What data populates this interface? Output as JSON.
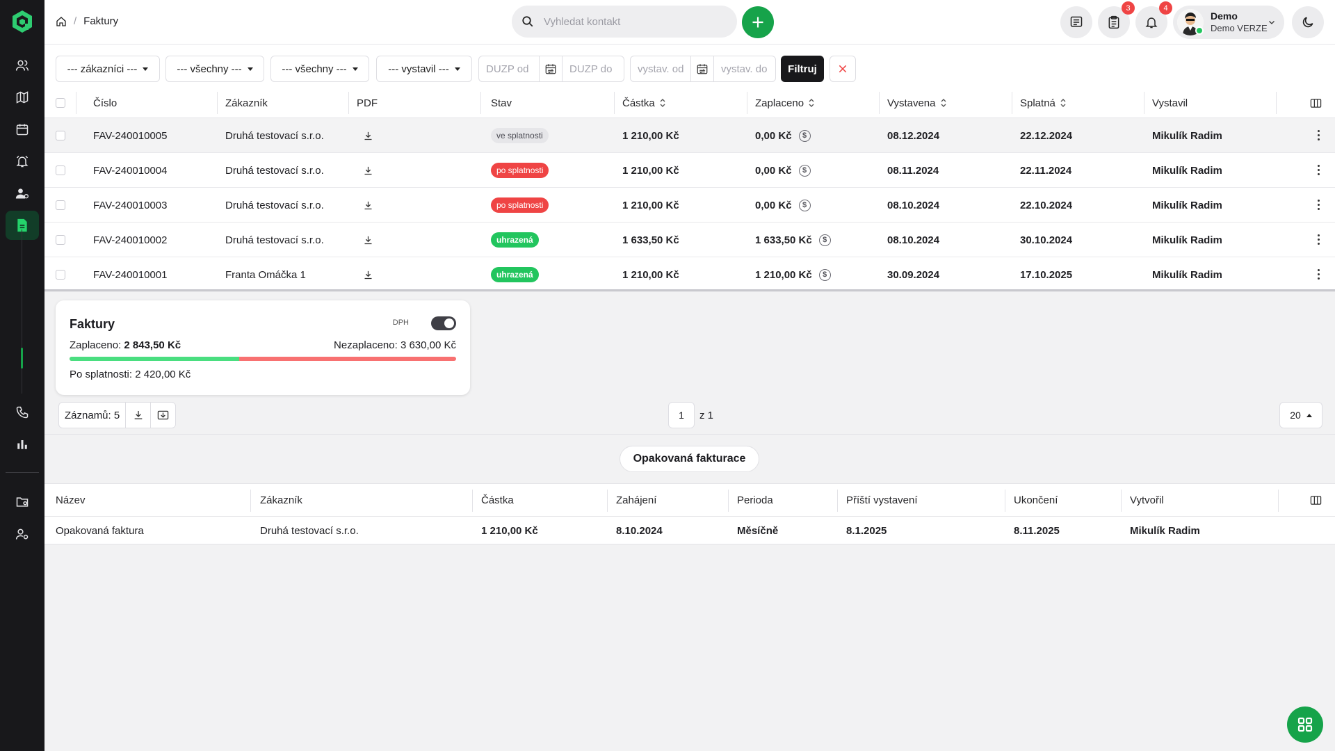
{
  "breadcrumb": {
    "current": "Faktury"
  },
  "search": {
    "placeholder": "Vyhledat kontakt"
  },
  "badges": {
    "tasks": "3",
    "notifications": "4"
  },
  "user": {
    "name": "Demo",
    "subtitle": "Demo VERZE"
  },
  "filters": {
    "customers": "--- zákazníci ---",
    "all1": "--- všechny ---",
    "all2": "--- všechny ---",
    "issuer": "--- vystavil ---",
    "duzp_from": "DUZP od",
    "duzp_to": "DUZP do",
    "issued_from": "vystav. od",
    "issued_to": "vystav. do",
    "filter_button": "Filtruj"
  },
  "invoices": {
    "headers": {
      "number": "Číslo",
      "customer": "Zákazník",
      "pdf": "PDF",
      "status": "Stav",
      "amount": "Částka",
      "paid": "Zaplaceno",
      "issued": "Vystavena",
      "due": "Splatná",
      "issuer": "Vystavil"
    },
    "rows": [
      {
        "number": "FAV-240010005",
        "customer": "Druhá testovací s.r.o.",
        "status": "ve splatnosti",
        "amount": "1 210,00 Kč",
        "paid": "0,00 Kč",
        "issued": "08.12.2024",
        "due": "22.12.2024",
        "issuer": "Mikulík Radim"
      },
      {
        "number": "FAV-240010004",
        "customer": "Druhá testovací s.r.o.",
        "status": "po splatnosti",
        "amount": "1 210,00 Kč",
        "paid": "0,00 Kč",
        "issued": "08.11.2024",
        "due": "22.11.2024",
        "issuer": "Mikulík Radim"
      },
      {
        "number": "FAV-240010003",
        "customer": "Druhá testovací s.r.o.",
        "status": "po splatnosti",
        "amount": "1 210,00 Kč",
        "paid": "0,00 Kč",
        "issued": "08.10.2024",
        "due": "22.10.2024",
        "issuer": "Mikulík Radim"
      },
      {
        "number": "FAV-240010002",
        "customer": "Druhá testovací s.r.o.",
        "status": "uhrazená",
        "amount": "1 633,50 Kč",
        "paid": "1 633,50 Kč",
        "issued": "08.10.2024",
        "due": "30.10.2024",
        "issuer": "Mikulík Radim"
      },
      {
        "number": "FAV-240010001",
        "customer": "Franta Omáčka 1",
        "status": "uhrazená",
        "amount": "1 210,00 Kč",
        "paid": "1 210,00 Kč",
        "issued": "30.09.2024",
        "due": "17.10.2025",
        "issuer": "Mikulík Radim"
      }
    ]
  },
  "summary": {
    "title": "Faktury",
    "dph_label": "DPH",
    "paid_label": "Zaplaceno:",
    "paid_value": "2 843,50 Kč",
    "unpaid_label": "Nezaplaceno:",
    "unpaid_value": "3 630,00 Kč",
    "overdue_label": "Po splatnosti:",
    "overdue_value": "2 420,00 Kč",
    "paid_fraction": 0.439
  },
  "pagination": {
    "records_label": "Záznamů:",
    "records_count": "5",
    "page": "1",
    "of": "z 1",
    "per_page": "20"
  },
  "recurring": {
    "button": "Opakovaná fakturace",
    "headers": {
      "name": "Název",
      "customer": "Zákazník",
      "amount": "Částka",
      "start": "Zahájení",
      "period": "Perioda",
      "next": "Příští vystavení",
      "end": "Ukončení",
      "creator": "Vytvořil"
    },
    "rows": [
      {
        "name": "Opakovaná faktura",
        "customer": "Druhá testovací s.r.o.",
        "amount": "1 210,00 Kč",
        "start": "8.10.2024",
        "period": "Měsíčně",
        "next": "8.1.2025",
        "end": "8.11.2025",
        "creator": "Mikulík Radim"
      }
    ]
  },
  "colors": {
    "accent": "#16a34a",
    "overdue": "#ef4444",
    "paid": "#22c55e",
    "sidebar": "#18181b"
  }
}
